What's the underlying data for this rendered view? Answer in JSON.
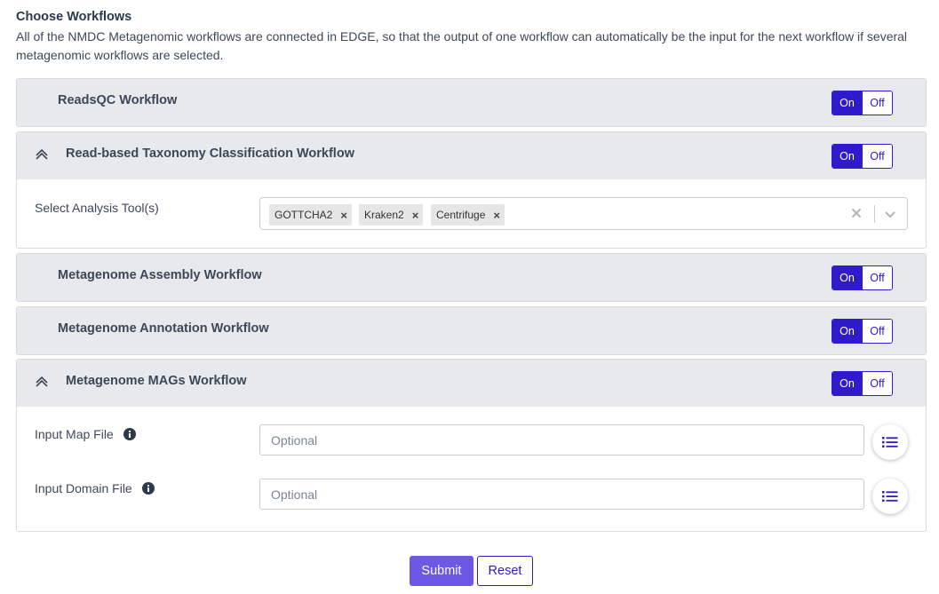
{
  "section": {
    "title": "Choose Workflows",
    "description": "All of the NMDC Metagenomic workflows are connected in EDGE, so that the output of one workflow can automatically be the input for the next workflow if several metagenomic workflows are selected."
  },
  "toggle": {
    "on": "On",
    "off": "Off"
  },
  "colors": {
    "accent": "#2f1bc9",
    "header_bg": "#e8e9ec",
    "submit_bg": "#6c57e6"
  },
  "workflows": {
    "readsqc": {
      "title": "ReadsQC Workflow",
      "state": "On"
    },
    "taxonomy": {
      "title": "Read-based Taxonomy Classification Workflow",
      "state": "On",
      "expanded": true,
      "field_label": "Select Analysis Tool(s)",
      "selected_tools": [
        "GOTTCHA2",
        "Kraken2",
        "Centrifuge"
      ],
      "remove_glyph": "×"
    },
    "assembly": {
      "title": "Metagenome Assembly Workflow",
      "state": "On"
    },
    "annotation": {
      "title": "Metagenome Annotation Workflow",
      "state": "On"
    },
    "mags": {
      "title": "Metagenome MAGs Workflow",
      "state": "On",
      "expanded": true,
      "map_file": {
        "label": "Input Map File",
        "placeholder": "Optional"
      },
      "domain_file": {
        "label": "Input Domain File",
        "placeholder": "Optional"
      }
    }
  },
  "icons": {
    "expanded": "chevron-up-icon",
    "info": "info-icon",
    "file_list": "list-icon",
    "clear": "close-icon",
    "dropdown": "chevron-down-icon"
  },
  "actions": {
    "submit": "Submit",
    "reset": "Reset"
  }
}
